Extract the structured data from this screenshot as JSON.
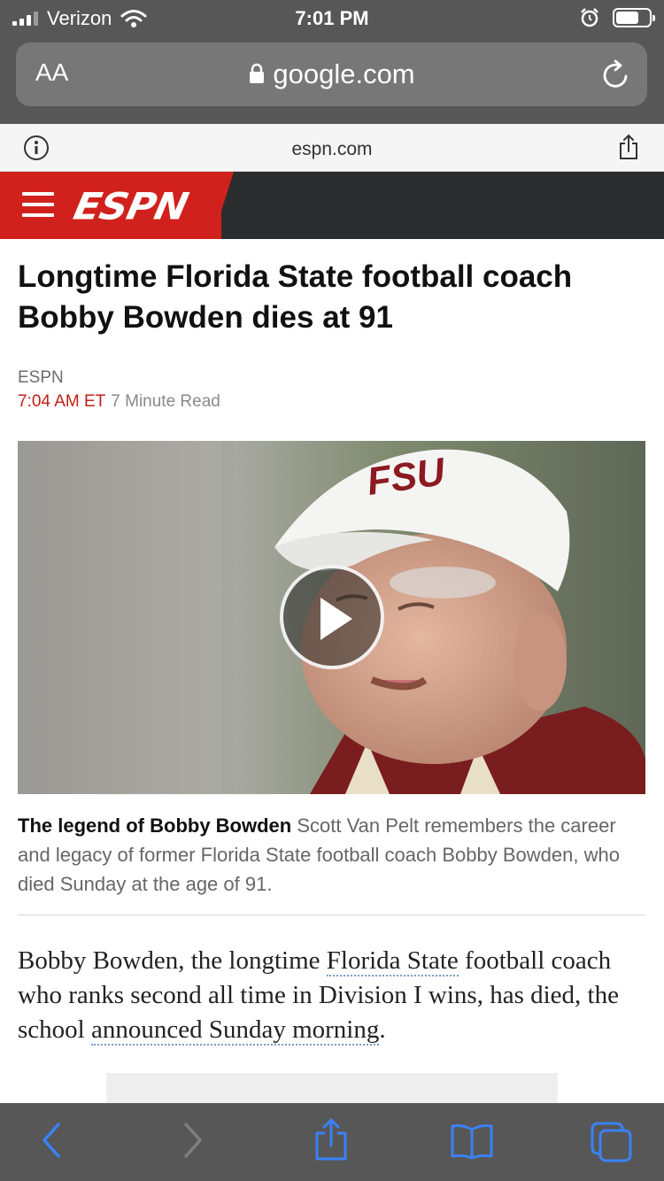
{
  "status_bar": {
    "carrier": "Verizon",
    "time": "7:01 PM",
    "signal_bars": 3,
    "icons": [
      "signal-icon",
      "wifi-icon",
      "alarm-icon",
      "battery-icon"
    ]
  },
  "browser": {
    "text_size_label": "AA",
    "host": "google.com",
    "reload_icon": "reload-icon",
    "lock_icon": "lock-icon"
  },
  "site_bar": {
    "domain": "espn.com",
    "info_icon": "info-icon",
    "share_icon": "share-icon"
  },
  "espn_header": {
    "logo": "ESPN",
    "menu_icon": "hamburger-icon"
  },
  "article": {
    "headline": "Longtime Florida State football coach Bobby Bowden dies at 91",
    "source": "ESPN",
    "time": "7:04 AM ET",
    "read_time": "7 Minute Read",
    "video": {
      "cap_text": "FSU",
      "play_icon": "play-icon"
    },
    "caption_title": "The legend of Bobby Bowden",
    "caption_text": "Scott Van Pelt remembers the career and legacy of former Florida State football coach Bobby Bowden, who died Sunday at the age of 91.",
    "body": {
      "part1": "Bobby Bowden, the longtime ",
      "link1": "Florida State",
      "part2": " football coach who ranks second all time in Division I wins, has died, the school ",
      "link2": "announced Sunday morning",
      "part3": "."
    }
  },
  "toolbar": {
    "icons": [
      "back-icon",
      "forward-icon",
      "share-icon",
      "bookmarks-icon",
      "tabs-icon"
    ],
    "accent": "#3a82f7"
  }
}
